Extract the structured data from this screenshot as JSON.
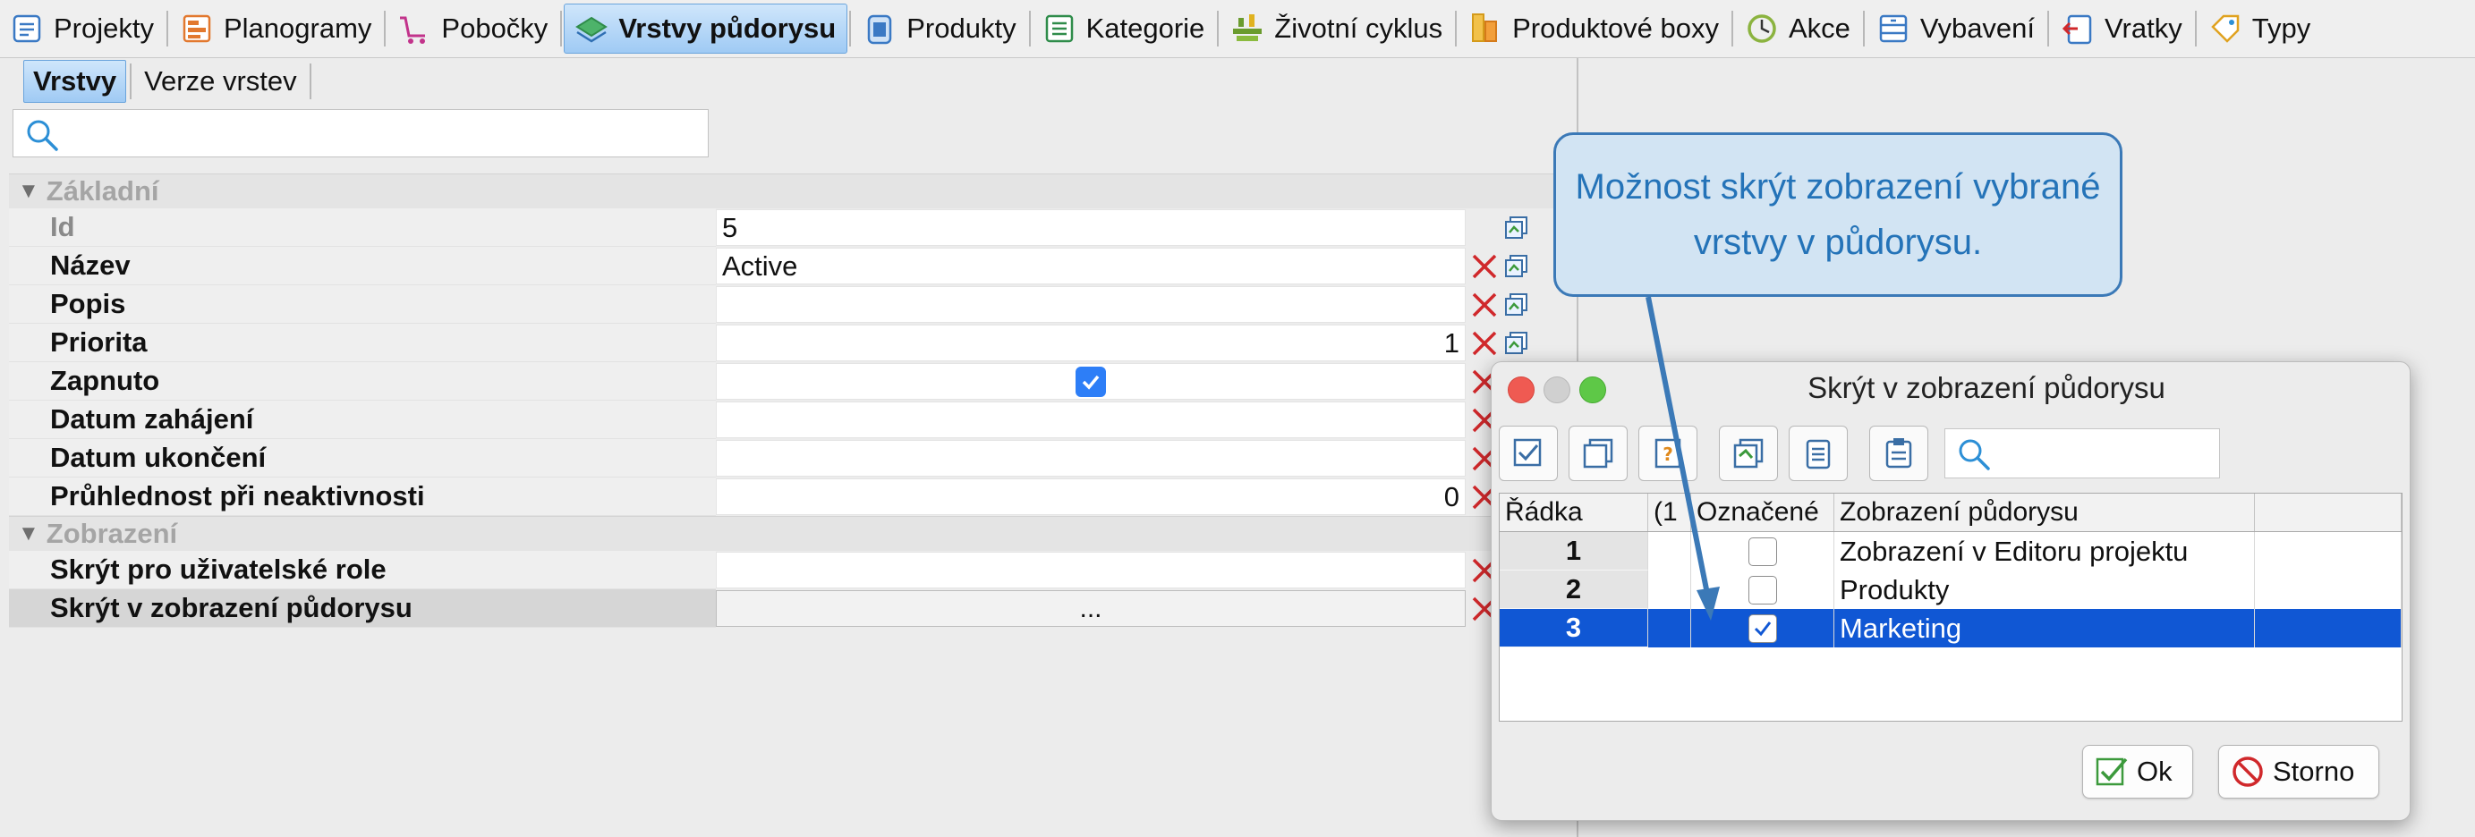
{
  "tabs": [
    {
      "label": "Projekty",
      "icon": "projects-icon"
    },
    {
      "label": "Planogramy",
      "icon": "planogram-icon"
    },
    {
      "label": "Pobočky",
      "icon": "cart-icon"
    },
    {
      "label": "Vrstvy půdorysu",
      "icon": "layers-icon",
      "active": true
    },
    {
      "label": "Produkty",
      "icon": "product-icon"
    },
    {
      "label": "Kategorie",
      "icon": "list-icon"
    },
    {
      "label": "Životní cyklus",
      "icon": "lifecycle-icon"
    },
    {
      "label": "Produktové boxy",
      "icon": "boxes-icon"
    },
    {
      "label": "Akce",
      "icon": "action-icon"
    },
    {
      "label": "Vybavení",
      "icon": "equipment-icon"
    },
    {
      "label": "Vratky",
      "icon": "returns-icon"
    },
    {
      "label": "Typy",
      "icon": "tag-icon"
    }
  ],
  "subtabs": [
    {
      "label": "Vrstvy",
      "active": true
    },
    {
      "label": "Verze vrstev"
    }
  ],
  "properties": {
    "group_basic": "Základní",
    "group_display": "Zobrazení",
    "rows_basic": [
      {
        "label": "Id",
        "value": "5",
        "dim": true,
        "delete": false
      },
      {
        "label": "Název",
        "value": "Active",
        "delete": true
      },
      {
        "label": "Popis",
        "value": "",
        "delete": true
      },
      {
        "label": "Priorita",
        "value": "1",
        "align": "right",
        "delete": true
      },
      {
        "label": "Zapnuto",
        "value": "",
        "checkbox": true,
        "delete": true
      },
      {
        "label": "Datum zahájení",
        "value": "",
        "delete": true
      },
      {
        "label": "Datum ukončení",
        "value": "",
        "delete": true
      },
      {
        "label": "Průhlednost při neaktivnosti",
        "value": "0",
        "align": "right",
        "delete": true
      }
    ],
    "rows_display": [
      {
        "label": "Skrýt pro uživatelské role",
        "value": "",
        "delete": true
      },
      {
        "label": "Skrýt v zobrazení půdorysu",
        "value": "...",
        "button": true,
        "delete": true
      }
    ]
  },
  "callout": {
    "text": "Možnost skrýt zobrazení vybrané vrstvy v půdorysu."
  },
  "dialog": {
    "title": "Skrýt v zobrazení půdorysu",
    "columns": {
      "row": "Řádka",
      "num": "(1",
      "marked": "Označené",
      "view": "Zobrazení půdorysu"
    },
    "rows": [
      {
        "num": "1",
        "checked": false,
        "view": "Zobrazení v Editoru projektu"
      },
      {
        "num": "2",
        "checked": false,
        "view": "Produkty"
      },
      {
        "num": "3",
        "checked": true,
        "view": "Marketing",
        "selected": true
      }
    ],
    "ok_label": "Ok",
    "cancel_label": "Storno"
  },
  "colors": {
    "accent": "#2d7ef7",
    "selection": "#1057d4",
    "callout_border": "#3b79b7",
    "callout_text": "#2473b8",
    "delete": "#d0282b"
  }
}
